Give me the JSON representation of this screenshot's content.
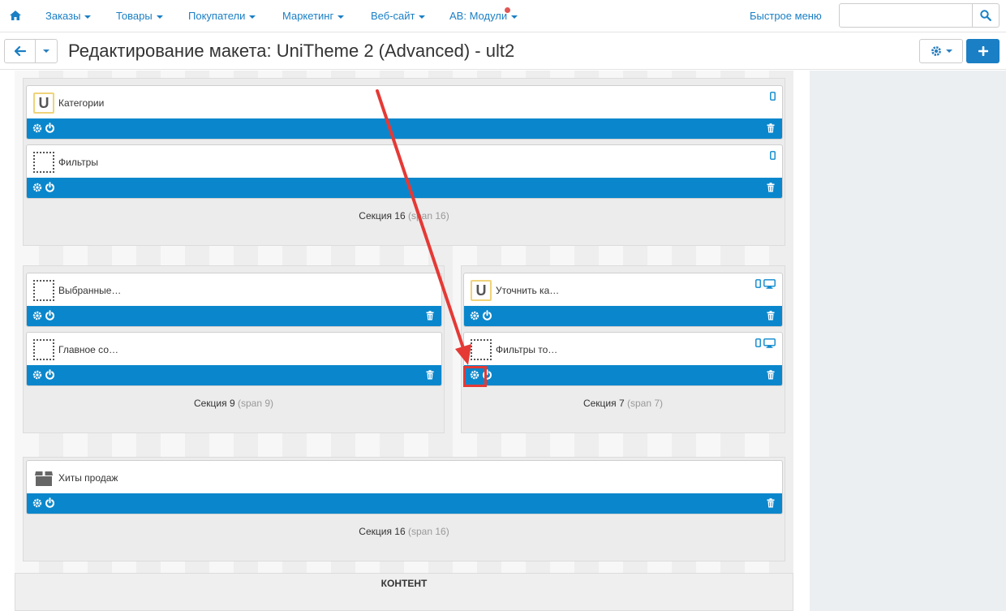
{
  "navbar": {
    "home_icon": "home-icon",
    "items": [
      {
        "label": "Заказы"
      },
      {
        "label": "Товары"
      },
      {
        "label": "Покупатели"
      },
      {
        "label": "Маркетинг"
      },
      {
        "label": "Веб-сайт"
      },
      {
        "label": "AB: Модули"
      }
    ],
    "quick_menu": "Быстрое меню",
    "search": {
      "value": "",
      "placeholder": ""
    }
  },
  "title_bar": {
    "title": "Редактирование макета: UniTheme 2 (Advanced) - ult2"
  },
  "colors": {
    "accent": "#1a7fc4",
    "block_bar": "#0a87cc",
    "highlight": "#e53935",
    "notification_dot": "#e15656"
  },
  "grids": [
    {
      "title": "Секция 16",
      "span_note": "(span 16)",
      "blocks": [
        {
          "name": "Категории",
          "icon": "unitheme-u-icon",
          "devices": [
            "phone-icon"
          ]
        },
        {
          "name": "Фильтры",
          "icon": "empty-block-icon",
          "devices": [
            "phone-icon"
          ]
        }
      ]
    },
    {
      "title": "Секция 9",
      "span_note": "(span 9)",
      "blocks": [
        {
          "name": "Выбранные…",
          "icon": "empty-block-icon",
          "devices": []
        },
        {
          "name": "Главное со…",
          "icon": "empty-block-icon",
          "devices": []
        }
      ]
    },
    {
      "title": "Секция 7",
      "span_note": "(span 7)",
      "blocks": [
        {
          "name": "Уточнить ка…",
          "icon": "unitheme-u-icon",
          "devices": [
            "phone-icon",
            "desktop-icon"
          ]
        },
        {
          "name": "Фильтры то…",
          "icon": "empty-block-icon",
          "devices": [
            "phone-icon",
            "desktop-icon"
          ]
        }
      ]
    },
    {
      "title": "Секция 16",
      "span_note": "(span 16)",
      "blocks": [
        {
          "name": "Хиты продаж",
          "icon": "box-icon",
          "devices": []
        }
      ]
    }
  ],
  "content_label": "КОНТЕНТ"
}
